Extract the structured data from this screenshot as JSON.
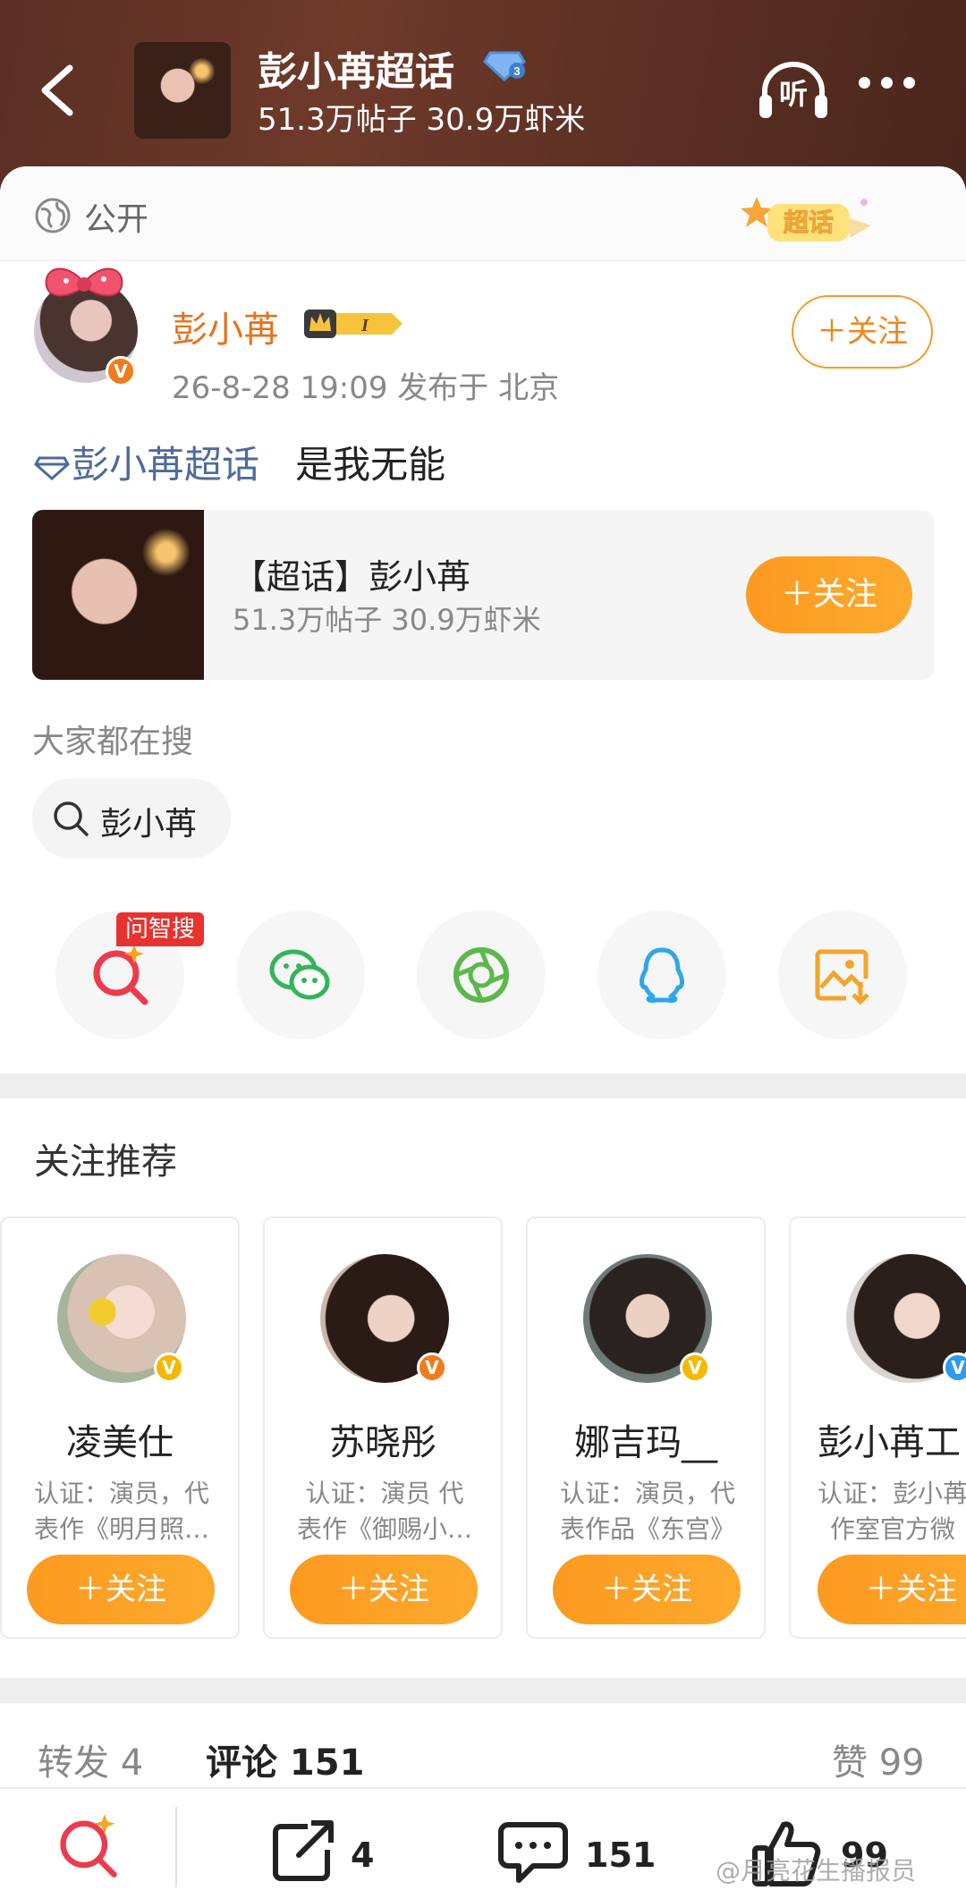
{
  "header": {
    "title": "彭小苒超话",
    "subtitle": "51.3万帖子 30.9万虾米",
    "listen_label": "听"
  },
  "visibility": {
    "label": "公开",
    "badge_text": "超话"
  },
  "post": {
    "author": "彭小苒",
    "meta": "26-8-28 19:09   发布于 北京",
    "follow_label": "＋关注",
    "topic_link": "彭小苒超话",
    "text": "是我无能"
  },
  "topic_card": {
    "title": "【超话】彭小苒",
    "subtitle": "51.3万帖子 30.9万虾米",
    "follow_label": "＋关注"
  },
  "search": {
    "heading": "大家都在搜",
    "chip": "彭小苒"
  },
  "share": {
    "ai_tag": "问智搜",
    "items": [
      "ai-search-icon",
      "wechat-icon",
      "moments-icon",
      "qq-icon",
      "save-image-icon"
    ]
  },
  "recommend": {
    "heading": "关注推荐",
    "cards": [
      {
        "name": "凌美仕",
        "desc1": "认证：演员，代",
        "desc2": "表作《明月照…",
        "follow": "＋关注",
        "badge_color": "#f5b800"
      },
      {
        "name": "苏晓彤",
        "desc1": "认证：演员 代",
        "desc2": "表作《御赐小…",
        "follow": "＋关注",
        "badge_color": "#f07d1b"
      },
      {
        "name": "娜吉玛__",
        "desc1": "认证：演员，代",
        "desc2": "表作品《东宫》",
        "follow": "＋关注",
        "badge_color": "#f5b800"
      },
      {
        "name": "彭小苒工",
        "desc1": "认证：彭小苒",
        "desc2": "作室官方微",
        "follow": "＋关注",
        "badge_color": "#2e9af0"
      }
    ]
  },
  "stats": {
    "repost": "转发 4",
    "comment": "评论 151",
    "like": "赞 99"
  },
  "bottom_bar": {
    "repost": "4",
    "comment": "151",
    "like": "99"
  },
  "watermark": "@月亮花生播报员"
}
